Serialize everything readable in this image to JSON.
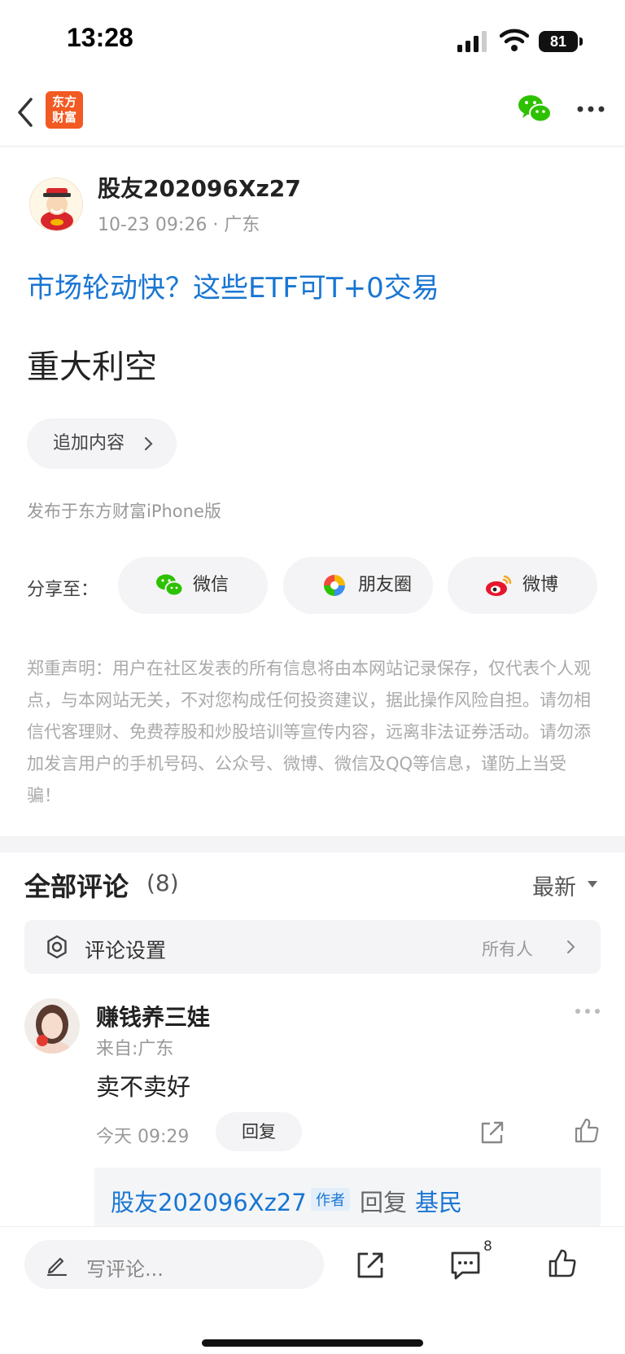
{
  "status_bar": {
    "time": "13:28",
    "battery": "81"
  },
  "nav": {
    "logo_line1": "东方",
    "logo_line2": "财富"
  },
  "post": {
    "author": "股友202096Xz27",
    "meta": "10-23 09:26 · 广东",
    "promo_link": "市场轮动快？这些ETF可T+0交易",
    "body": "重大利空",
    "add_content_label": "追加内容",
    "publish_source": "发布于东方财富iPhone版"
  },
  "share": {
    "label": "分享至：",
    "wechat": "微信",
    "moments": "朋友圈",
    "weibo": "微博"
  },
  "disclaimer": "郑重声明：用户在社区发表的所有信息将由本网站记录保存，仅代表个人观点，与本网站无关，不对您构成任何投资建议，据此操作风险自担。请勿相信代客理财、免费荐股和炒股培训等宣传内容，远离非法证券活动。请勿添加发言用户的手机号码、公众号、微博、微信及QQ等信息，谨防上当受骗！",
  "comments": {
    "title": "全部评论",
    "count": "(8)",
    "sort": "最新",
    "settings_label": "评论设置",
    "settings_value": "所有人",
    "items": [
      {
        "name": "赚钱养三娃",
        "location": "来自:广东",
        "text": "卖不卖好",
        "time": "今天 09:29",
        "reply_label": "回复",
        "reply": {
          "author": "股友202096Xz27",
          "tag": "作者",
          "verb": "回复",
          "target": "基民"
        }
      }
    ]
  },
  "bottom_bar": {
    "input_placeholder": "写评论...",
    "comment_count": "8"
  },
  "colors": {
    "brand": "#f15a22",
    "link": "#1976d2",
    "wechat": "#2dc100"
  }
}
